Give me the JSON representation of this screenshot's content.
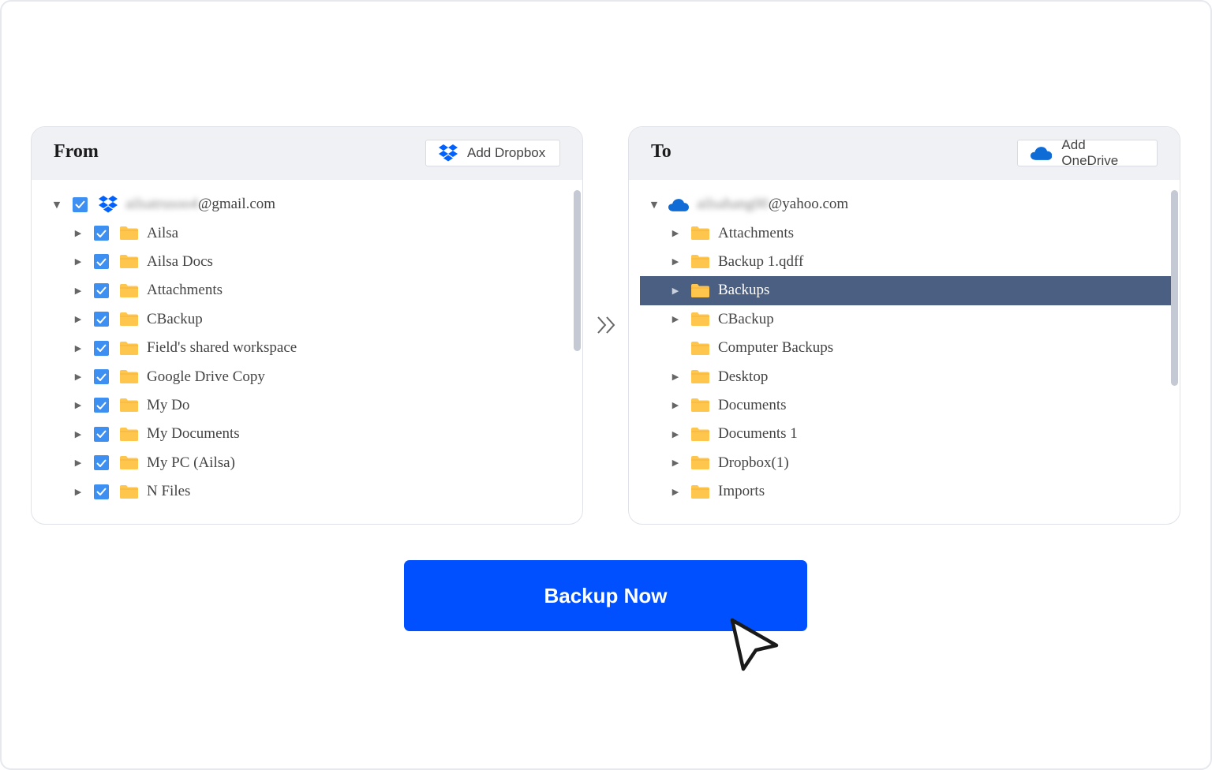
{
  "from_panel": {
    "title": "From",
    "add_button_label": "Add Dropbox",
    "account": {
      "masked_name": "ailsatrusoo4",
      "domain": "@gmail.com"
    },
    "items": [
      {
        "label": "Ailsa",
        "checked": true
      },
      {
        "label": "Ailsa Docs",
        "checked": true
      },
      {
        "label": "Attachments",
        "checked": true
      },
      {
        "label": "CBackup",
        "checked": true
      },
      {
        "label": "Field's shared workspace",
        "checked": true
      },
      {
        "label": "Google Drive Copy",
        "checked": true
      },
      {
        "label": "My Do",
        "checked": true
      },
      {
        "label": "My Documents",
        "checked": true
      },
      {
        "label": "My PC (Ailsa)",
        "checked": true
      },
      {
        "label": "N Files",
        "checked": true
      }
    ]
  },
  "to_panel": {
    "title": "To",
    "add_button_label": "Add OneDrive",
    "account": {
      "masked_name": "ailsahang00",
      "domain": "@yahoo.com"
    },
    "items": [
      {
        "label": "Attachments",
        "expandable": true,
        "selected": false
      },
      {
        "label": "Backup 1.qdff",
        "expandable": true,
        "selected": false
      },
      {
        "label": "Backups",
        "expandable": true,
        "selected": true
      },
      {
        "label": "CBackup",
        "expandable": true,
        "selected": false
      },
      {
        "label": "Computer Backups",
        "expandable": false,
        "selected": false
      },
      {
        "label": "Desktop",
        "expandable": true,
        "selected": false
      },
      {
        "label": "Documents",
        "expandable": true,
        "selected": false
      },
      {
        "label": "Documents 1",
        "expandable": true,
        "selected": false
      },
      {
        "label": "Dropbox(1)",
        "expandable": true,
        "selected": false
      },
      {
        "label": "Imports",
        "expandable": true,
        "selected": false
      }
    ]
  },
  "action": {
    "backup_label": "Backup Now"
  },
  "colors": {
    "primary_button": "#0050ff",
    "checkbox": "#3d8ff2",
    "selected_row": "#4a5f82",
    "folder": "#ffc64d",
    "dropbox": "#0061fe",
    "onedrive": "#0f6cd6"
  },
  "icons": {
    "dropbox": "dropbox-icon",
    "onedrive": "onedrive-icon",
    "folder": "folder-icon",
    "arrow": "double-chevron-right-icon",
    "cursor": "mouse-pointer-icon"
  }
}
